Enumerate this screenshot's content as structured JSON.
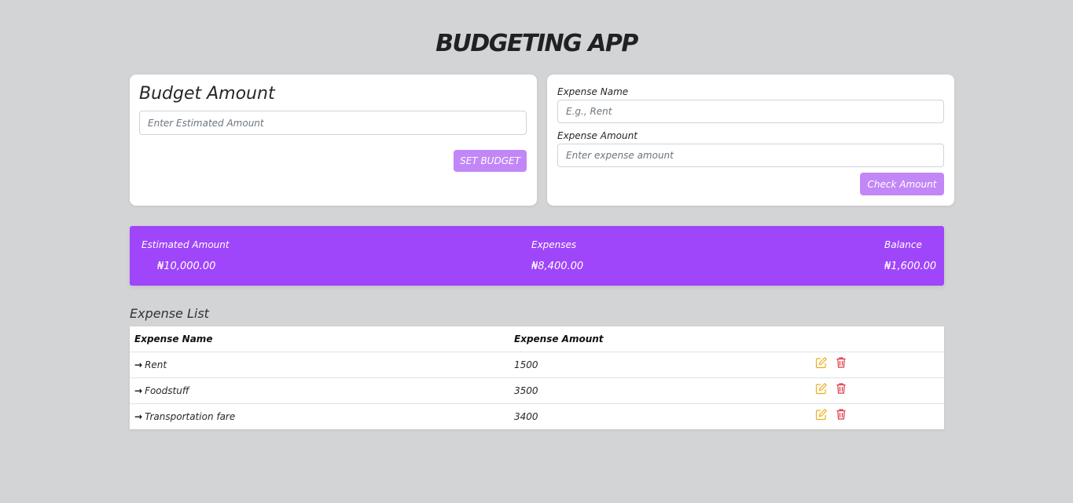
{
  "app": {
    "title": "BUDGETING APP"
  },
  "budget": {
    "heading": "Budget Amount",
    "placeholder": "Enter Estimated Amount",
    "button_label": "SET BUDGET"
  },
  "expense_form": {
    "name_label": "Expense Name",
    "name_placeholder": "E.g., Rent",
    "amount_label": "Expense Amount",
    "amount_placeholder": "Enter expense amount",
    "button_label": "Check Amount"
  },
  "summary": {
    "estimated_label": "Estimated Amount",
    "estimated_value": "₦10,000.00",
    "expenses_label": "Expenses",
    "expenses_value": "₦8,400.00",
    "balance_label": "Balance",
    "balance_value": "₦1,600.00"
  },
  "expense_list": {
    "heading": "Expense List",
    "columns": [
      "Expense Name",
      "Expense Amount"
    ],
    "rows": [
      {
        "name": "Rent",
        "amount": "1500"
      },
      {
        "name": "Foodstuff",
        "amount": "3500"
      },
      {
        "name": "Transportation fare",
        "amount": "3400"
      }
    ]
  },
  "colors": {
    "accent": "#9f45fa",
    "button": "#c287f7",
    "edit_icon": "#f0ad1e",
    "delete_icon": "#dc3545",
    "background": "#d3d4d6"
  },
  "icons": {
    "row_marker": "arrow-right-icon",
    "edit": "edit-icon",
    "delete": "trash-icon"
  }
}
